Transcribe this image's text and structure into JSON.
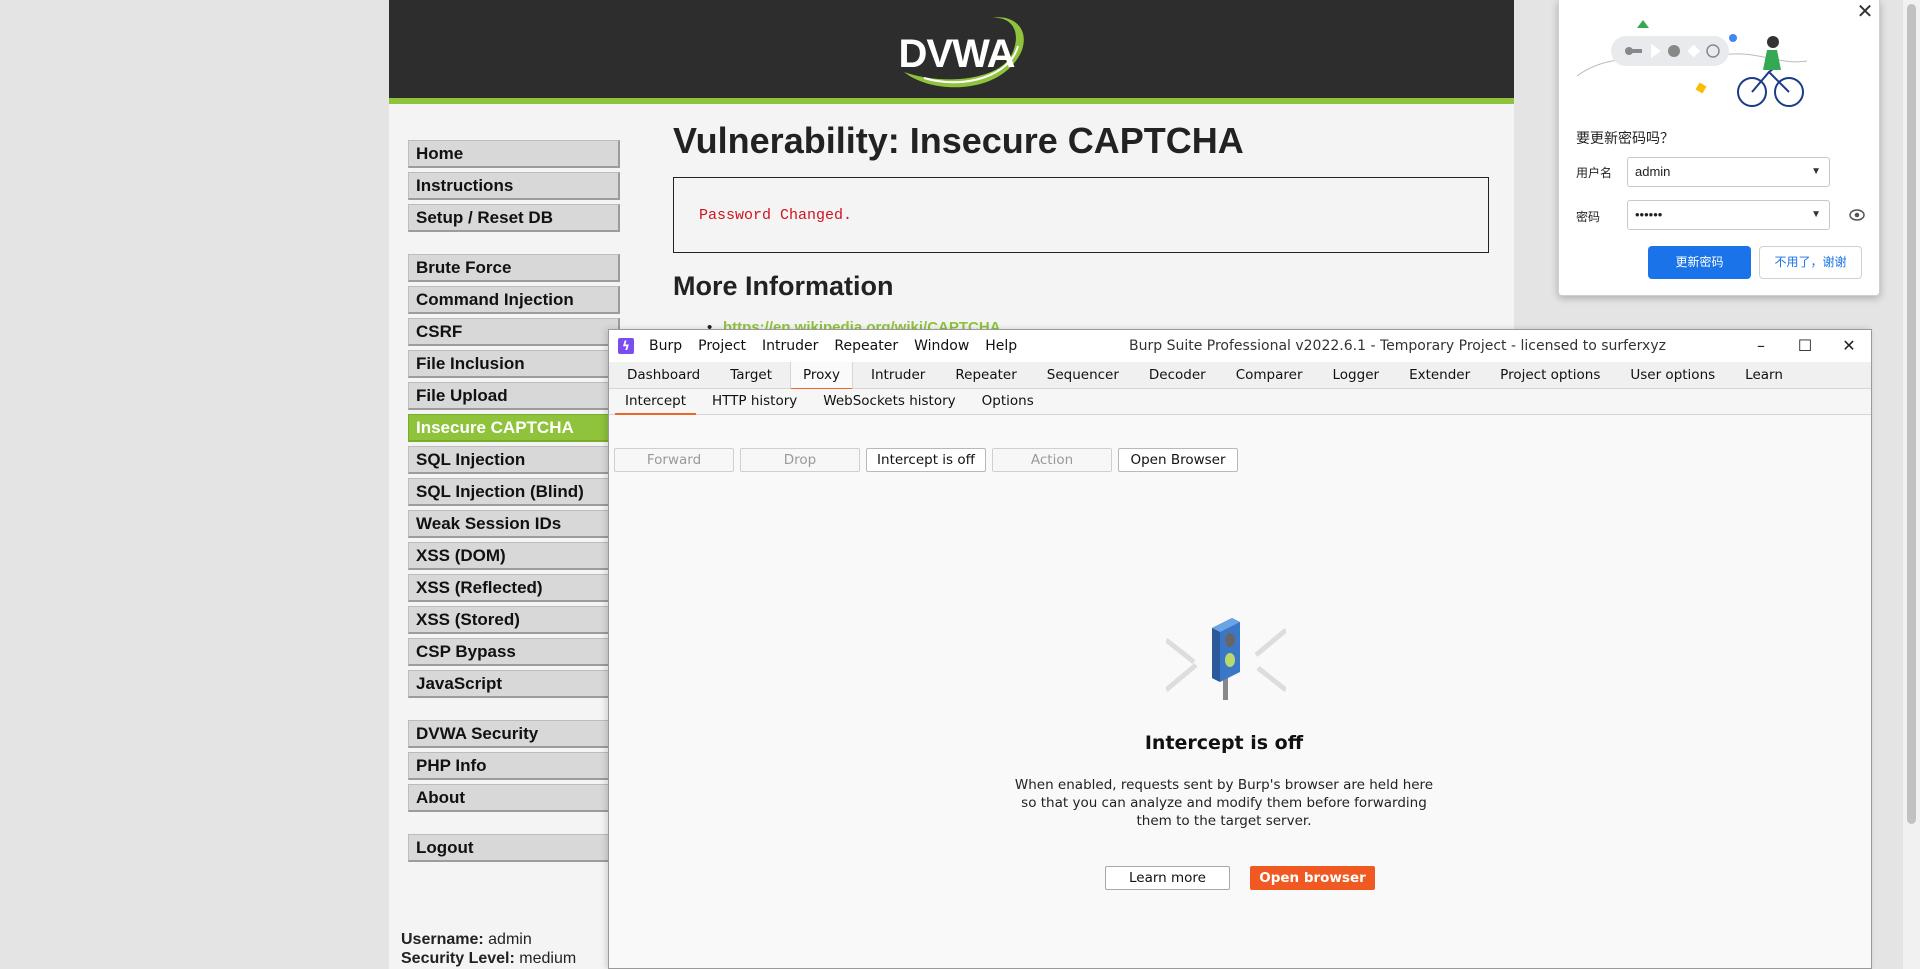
{
  "dvwa": {
    "logo": "DVWA",
    "menu_groups": [
      [
        "Home",
        "Instructions",
        "Setup / Reset DB"
      ],
      [
        "Brute Force",
        "Command Injection",
        "CSRF",
        "File Inclusion",
        "File Upload",
        "Insecure CAPTCHA",
        "SQL Injection",
        "SQL Injection (Blind)",
        "Weak Session IDs",
        "XSS (DOM)",
        "XSS (Reflected)",
        "XSS (Stored)",
        "CSP Bypass",
        "JavaScript"
      ],
      [
        "DVWA Security",
        "PHP Info",
        "About"
      ],
      [
        "Logout"
      ]
    ],
    "active_item": "Insecure CAPTCHA",
    "title": "Vulnerability: Insecure CAPTCHA",
    "message": "Password Changed.",
    "more_info_heading": "More Information",
    "more_info_link": "https://en.wikipedia.org/wiki/CAPTCHA",
    "username_label": "Username:",
    "username_value": "admin",
    "security_label": "Security Level:",
    "security_value": "medium"
  },
  "password_popup": {
    "question": "要更新密码吗？",
    "username_label": "用户名",
    "username_value": "admin",
    "password_label": "密码",
    "password_value": "••••••",
    "update_button": "更新密码",
    "no_thanks_button": "不用了，谢谢",
    "close_glyph": "✕"
  },
  "burp": {
    "menu": [
      "Burp",
      "Project",
      "Intruder",
      "Repeater",
      "Window",
      "Help"
    ],
    "window_title": "Burp Suite Professional v2022.6.1 - Temporary Project - licensed to surferxyz",
    "tabs": [
      "Dashboard",
      "Target",
      "Proxy",
      "Intruder",
      "Repeater",
      "Sequencer",
      "Decoder",
      "Comparer",
      "Logger",
      "Extender",
      "Project options",
      "User options",
      "Learn"
    ],
    "active_tab": "Proxy",
    "subtabs": [
      "Intercept",
      "HTTP history",
      "WebSockets history",
      "Options"
    ],
    "active_subtab": "Intercept",
    "toolbar": {
      "forward": "Forward",
      "drop": "Drop",
      "intercept_toggle": "Intercept is off",
      "action": "Action",
      "open_browser": "Open Browser"
    },
    "empty_state": {
      "title": "Intercept is off",
      "desc_line1": "When enabled, requests sent by Burp's browser are held here",
      "desc_line2": "so that you can analyze and modify them before forwarding",
      "desc_line3": "them to the target server.",
      "learn_more": "Learn more",
      "open_browser": "Open browser"
    }
  },
  "colors": {
    "dvwa_green": "#8fc33c",
    "burp_orange": "#f05a22",
    "chrome_blue": "#1a73e8",
    "error_red": "#d0141e"
  }
}
